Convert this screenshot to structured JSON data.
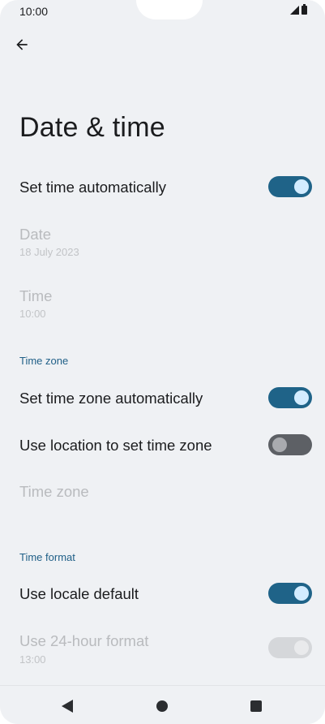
{
  "status_bar": {
    "time": "10:00"
  },
  "page": {
    "title": "Date & time"
  },
  "settings": {
    "set_time_auto": {
      "label": "Set time automatically",
      "checked": true
    },
    "date": {
      "label": "Date",
      "value": "18 July 2023"
    },
    "time": {
      "label": "Time",
      "value": "10:00"
    },
    "time_zone_header": "Time zone",
    "set_tz_auto": {
      "label": "Set time zone automatically",
      "checked": true
    },
    "use_location_tz": {
      "label": "Use location to set time zone",
      "checked": false
    },
    "time_zone": {
      "label": "Time zone"
    },
    "time_format_header": "Time format",
    "use_locale_default": {
      "label": "Use locale default",
      "checked": true
    },
    "use_24_hour": {
      "label": "Use 24-hour format",
      "value": "13:00",
      "checked": true
    }
  },
  "colors": {
    "background": "#eff1f4",
    "accent": "#1f6388",
    "section_header": "#1f5f87",
    "disabled_text": "#b9bbbe"
  },
  "icons": {
    "back": "arrow-left-icon",
    "signal": "signal-icon",
    "battery": "battery-icon",
    "nav_back": "triangle-back-icon",
    "nav_home": "circle-home-icon",
    "nav_recents": "square-recents-icon"
  }
}
